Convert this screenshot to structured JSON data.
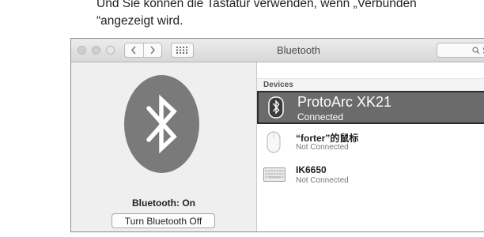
{
  "caption": {
    "line1": "Und Sie können die Tastatur verwenden, wenn „Verbunden",
    "line2": "“angezeigt wird."
  },
  "window": {
    "title": "Bluetooth",
    "search_placeholder": "S",
    "toolbar": {
      "back_icon": "chevron-left-icon",
      "forward_icon": "chevron-right-icon",
      "grid_icon": "grid-icon",
      "search_icon": "search-icon"
    }
  },
  "bluetooth_panel": {
    "icon": "bluetooth-icon",
    "status": "Bluetooth: On",
    "toggle_label": "Turn Bluetooth Off"
  },
  "devices": {
    "header": "Devices",
    "items": [
      {
        "name": "ProtoArc XK21",
        "status": "Connected",
        "icon": "bluetooth-icon",
        "selected": true
      },
      {
        "name": "“forter”的鼠标",
        "status": "Not Connected",
        "icon": "mouse-icon",
        "selected": false
      },
      {
        "name": "IK6650",
        "status": "Not Connected",
        "icon": "keyboard-icon",
        "selected": false
      }
    ]
  },
  "colors": {
    "selection": "#6b6b6b",
    "bluetooth_logo_bg": "#7a7a7a"
  }
}
